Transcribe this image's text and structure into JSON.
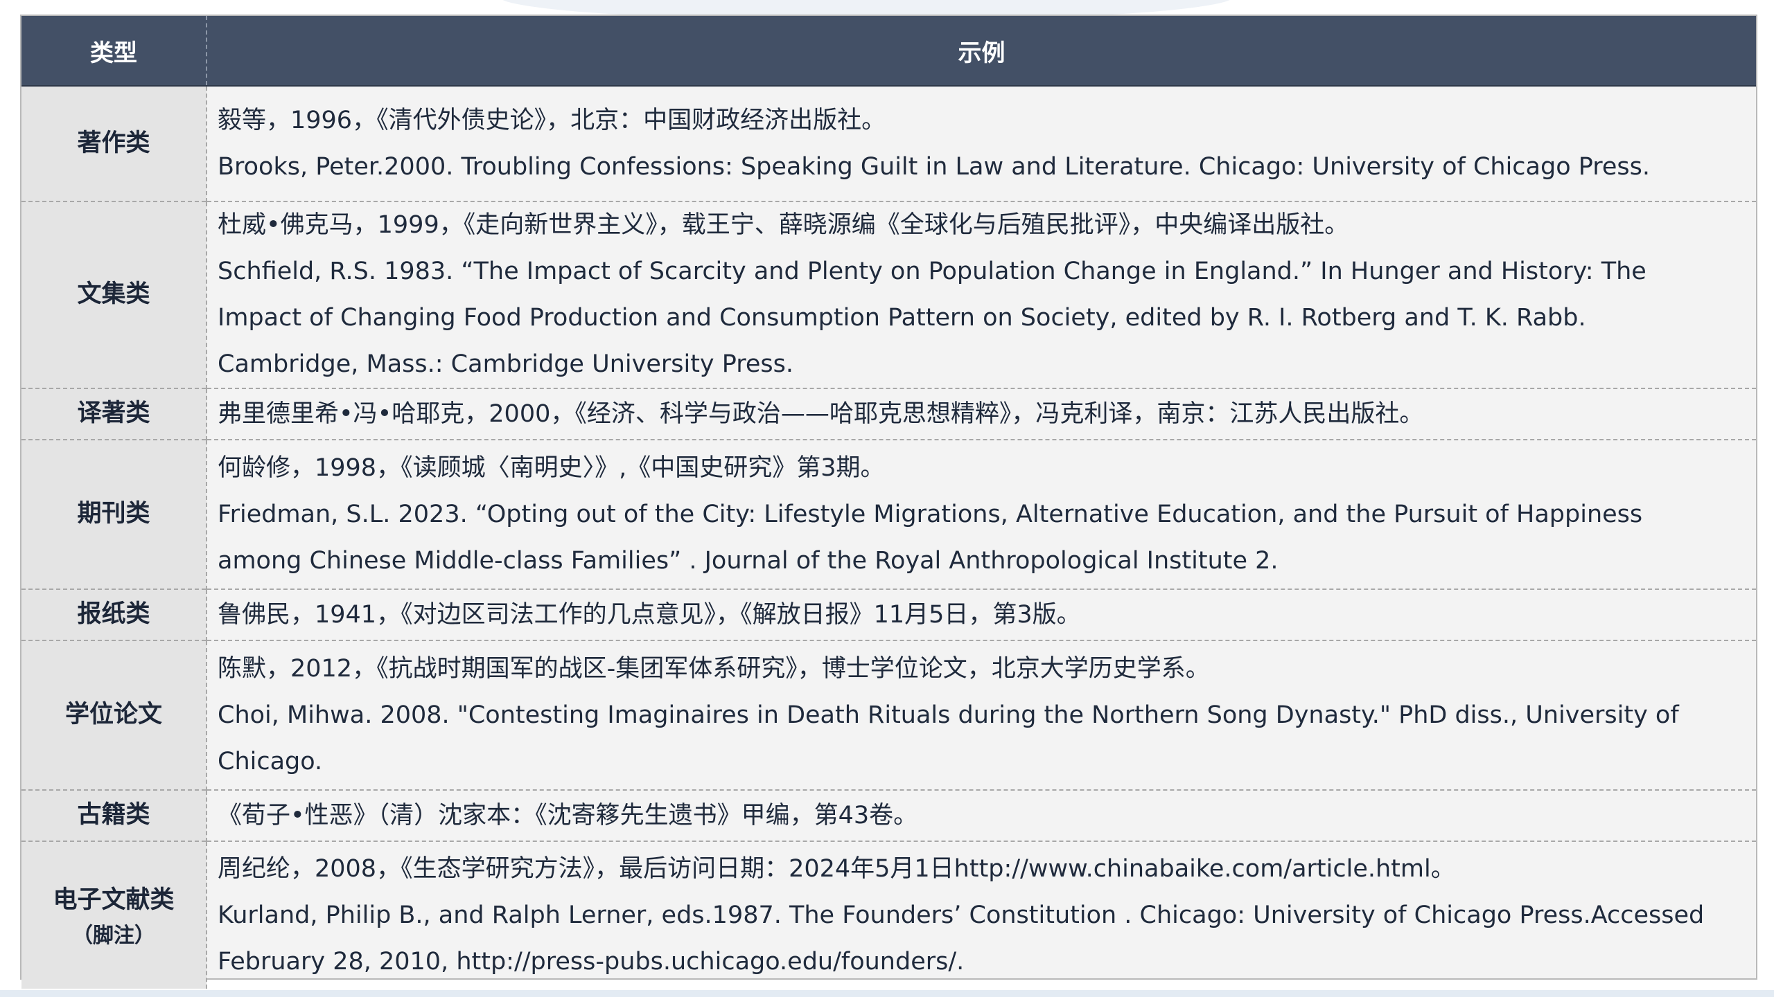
{
  "table": {
    "headers": {
      "type": "类型",
      "example": "示例"
    },
    "rows": [
      {
        "type": "著作类",
        "lines": [
          "毅等，1996，《清代外债史论》，北京：中国财政经济出版社。",
          "Brooks, Peter.2000. Troubling Confessions: Speaking Guilt in Law and Literature. Chicago: University of Chicago Press."
        ]
      },
      {
        "type": "文集类",
        "lines": [
          "杜威•佛克马，1999，《走向新世界主义》，载王宁、薛晓源编《全球化与后殖民批评》，中央编译出版社。",
          "Schfield, R.S. 1983. “The Impact of Scarcity and Plenty on Population Change in England.”  In Hunger and History: The Impact of Changing Food Production and Consumption Pattern on Society, edited by R. I. Rotberg and T. K. Rabb. Cambridge, Mass.: Cambridge University Press."
        ]
      },
      {
        "type": "译著类",
        "lines": [
          "弗里德里希•冯•哈耶克，2000，《经济、科学与政治——哈耶克思想精粹》，冯克利译，南京：江苏人民出版社。"
        ]
      },
      {
        "type": "期刊类",
        "lines": [
          "何龄修，1998，《读顾城〈南明史〉》,《中国史研究》第3期。",
          "Friedman, S.L. 2023. “Opting out of the City: Lifestyle Migrations, Alternative Education, and the Pursuit of Happiness among Chinese Middle-class Families” . Journal of the Royal Anthropological Institute 2."
        ]
      },
      {
        "type": "报纸类",
        "lines": [
          "鲁佛民，1941，《对边区司法工作的几点意见》，《解放日报》11月5日，第3版。"
        ]
      },
      {
        "type": "学位论文",
        "lines": [
          "陈默，2012，《抗战时期国军的战区-集团军体系研究》，博士学位论文，北京大学历史学系。",
          "Choi, Mihwa. 2008. \"Contesting Imaginaires in Death Rituals during the Northern Song Dynasty.\" PhD diss., University of Chicago."
        ]
      },
      {
        "type": "古籍类",
        "lines": [
          "《荀子•性恶》（清）沈家本：《沈寄簃先生遗书》甲编，第43卷。"
        ]
      },
      {
        "type": "电子文献类",
        "type_note": "（脚注）",
        "lines": [
          "周纪纶，2008，《生态学研究方法》，最后访问日期：2024年5月1日http://www.chinabaike.com/article.html。",
          "Kurland, Philip B., and Ralph Lerner, eds.1987. The Founders’ Constitution . Chicago: University of Chicago Press.Accessed February 28, 2010, http://press-pubs.uchicago.edu/founders/."
        ]
      }
    ]
  }
}
